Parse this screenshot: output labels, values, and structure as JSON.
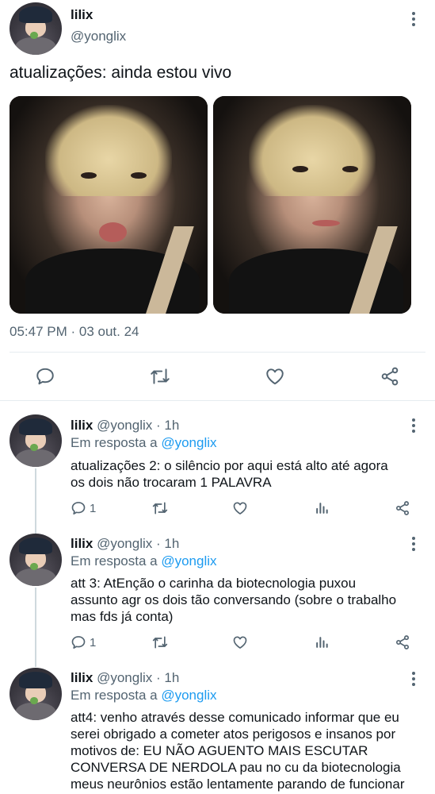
{
  "main_tweet": {
    "name": "lilix",
    "handle": "@yonglix",
    "text": "atualizações: ainda estou vivo",
    "timestamp": "05:47 PM · 03 out. 24",
    "actions": [
      "reply-icon",
      "retweet-icon",
      "like-icon",
      "share-icon"
    ]
  },
  "replies": [
    {
      "name": "lilix",
      "handle": "@yonglix",
      "time": "· 1h",
      "reply_prefix": "Em resposta a",
      "reply_handle": "@yonglix",
      "lines": [
        "atualizações 2: o silêncio por aqui está alto até agora",
        "os dois não trocaram 1 PALAVRA"
      ],
      "reply_count": "1"
    },
    {
      "name": "lilix",
      "handle": "@yonglix",
      "time": "· 1h",
      "reply_prefix": "Em resposta a",
      "reply_handle": "@yonglix",
      "lines": [
        "att 3: AtEnção o carinha da biotecnologia puxou",
        "assunto agr os dois tão conversando (sobre o trabalho",
        "mas fds já conta)"
      ],
      "reply_count": "1"
    },
    {
      "name": "lilix",
      "handle": "@yonglix",
      "time": "· 1h",
      "reply_prefix": "Em resposta a",
      "reply_handle": "@yonglix",
      "lines": [
        "att4: venho através desse comunicado informar que eu",
        "serei obrigado a cometer atos perigosos e insanos por",
        "motivos de: EU NÃO AGUENTO MAIS ESCUTAR",
        "CONVERSA DE NERDOLA pau no cu da biotecnologia",
        "meus neurônios estão lentamente parando de funcionar"
      ]
    }
  ],
  "colors": {
    "text": "#0f1419",
    "secondary": "#536471",
    "link": "#1d9bf0",
    "divider": "#e6ecf0"
  }
}
